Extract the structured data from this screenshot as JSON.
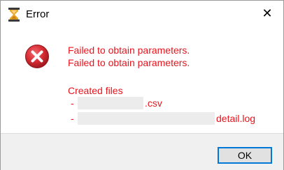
{
  "window": {
    "title": "Error",
    "close_glyph": "✕",
    "app_icon": "hourglass-icon"
  },
  "message": {
    "icon": "error-x-circle-icon",
    "line1": "Failed to obtain parameters.",
    "line2": "Failed to obtain parameters.",
    "created_heading": "Created files",
    "file1_bullet": "-",
    "file1_suffix": ".csv",
    "file2_bullet": "-",
    "file2_suffix": "detail.log"
  },
  "footer": {
    "ok_label": "OK"
  },
  "colors": {
    "message_text": "#e8141c",
    "error_icon": "#c8222a",
    "button_focus_border": "#0078d7",
    "footer_bg": "#f0f0f0"
  }
}
